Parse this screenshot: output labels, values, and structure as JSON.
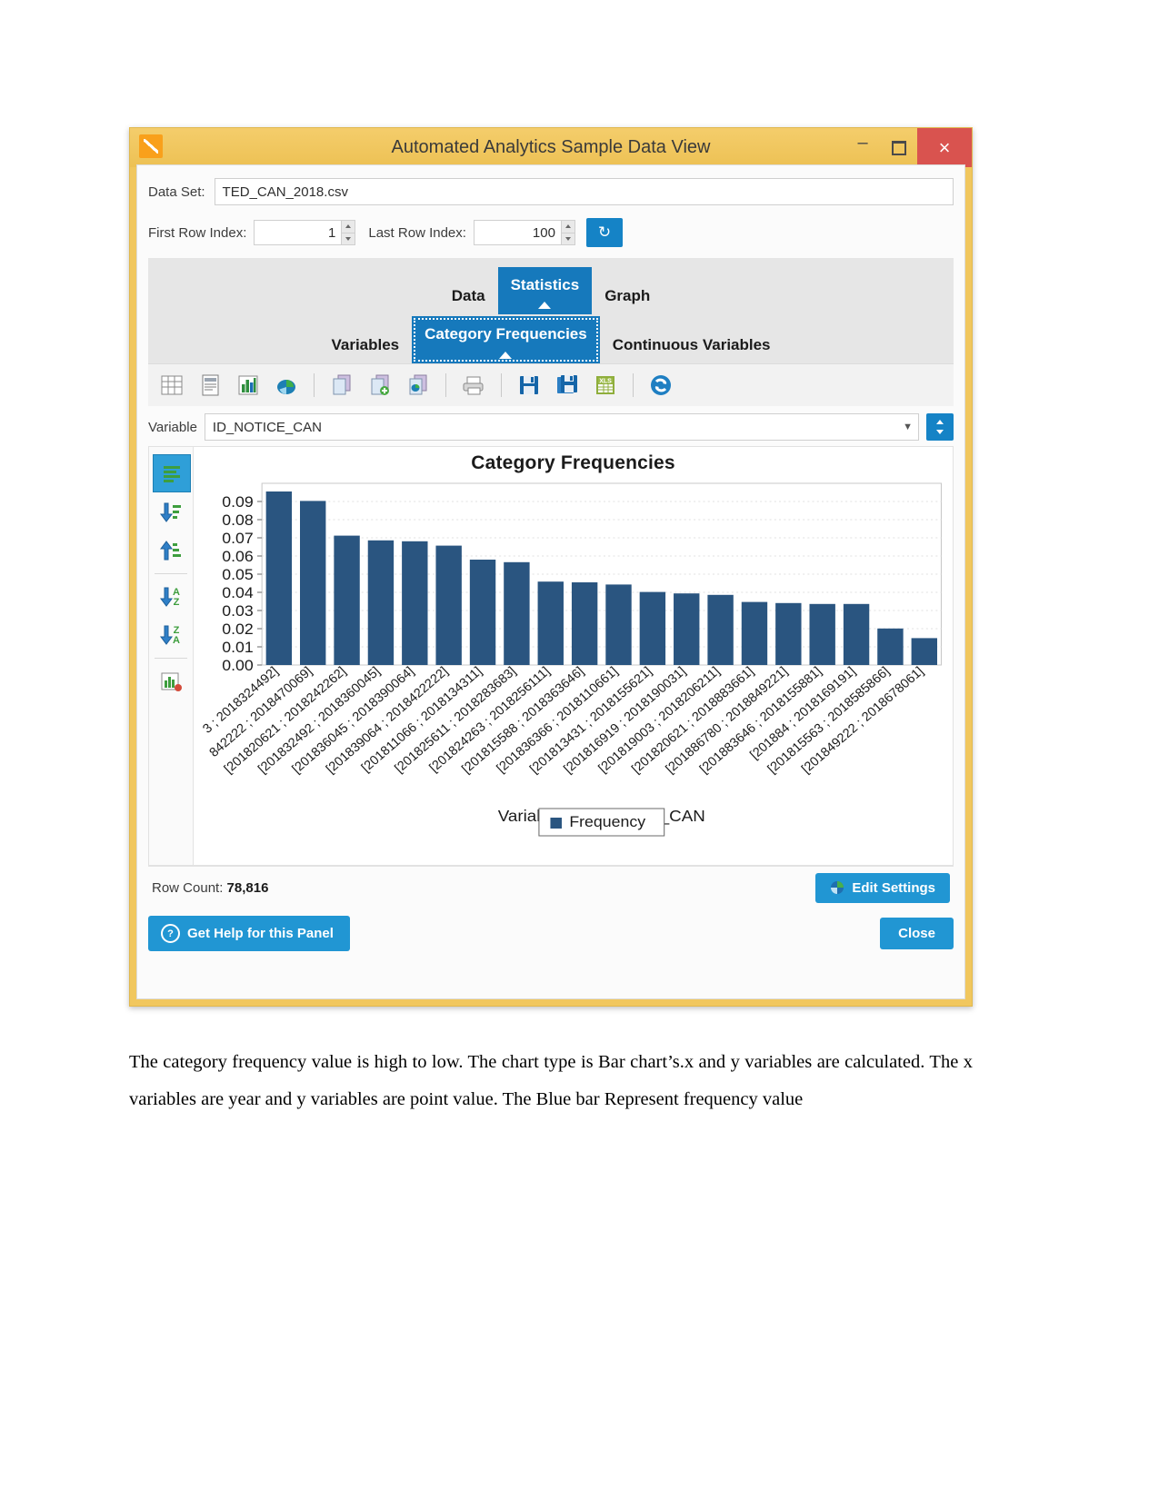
{
  "window": {
    "title": "Automated Analytics Sample Data View",
    "logo_icon": "app-chart-icon",
    "minimize_icon": "–",
    "maximize_icon": "□",
    "close_icon": "×"
  },
  "dataset": {
    "label": "Data Set:",
    "value": "TED_CAN_2018.csv"
  },
  "rowindex": {
    "first_label": "First Row Index:",
    "first_value": "1",
    "last_label": "Last Row Index:",
    "last_value": "100",
    "refresh_icon": "↻"
  },
  "tabs": {
    "primary": [
      {
        "label": "Data",
        "active": false
      },
      {
        "label": "Statistics",
        "active": true
      },
      {
        "label": "Graph",
        "active": false
      }
    ],
    "secondary": [
      {
        "label": "Variables",
        "active": false
      },
      {
        "label": "Category Frequencies",
        "active": true
      },
      {
        "label": "Continuous Variables",
        "active": false
      }
    ]
  },
  "toolbar": {
    "icons": [
      "table-grid-icon",
      "report-document-icon",
      "bar-chart-icon",
      "pie-chart-icon",
      "copy-page-icon",
      "add-page-icon",
      "copy-chart-page-icon",
      "print-icon",
      "save-icon",
      "save-as-icon",
      "export-xls-icon",
      "refresh-globe-icon"
    ]
  },
  "variable": {
    "label": "Variable",
    "value": "ID_NOTICE_CAN",
    "dropdown_icon": "chevron-down-icon",
    "sort_icon": "sort-updown-icon"
  },
  "side_tools": {
    "icons": [
      "align-bars-icon",
      "sort-descending-value-icon",
      "sort-ascending-value-icon",
      "sort-a-z-icon",
      "sort-z-a-icon",
      "chart-options-icon"
    ]
  },
  "status": {
    "row_count_label": "Row Count:",
    "row_count_value": "78,816",
    "edit_settings_label": "Edit Settings",
    "edit_settings_icon": "palette-icon"
  },
  "footer": {
    "help_label": "Get Help for this Panel",
    "help_icon": "question-circle-icon",
    "close_label": "Close"
  },
  "paragraph": "The category frequency value is high to low. The chart type is Bar chart’s.x and y variables are calculated. The x variables are year and y variables are point value. The Blue bar Represent frequency value",
  "chart_data": {
    "type": "bar",
    "title": "Category Frequencies",
    "xlabel": "Variable: ID_NOTICE_CAN",
    "ylabel": "",
    "ylim": [
      0,
      0.1
    ],
    "yticks": [
      "0.00",
      "0.01",
      "0.02",
      "0.03",
      "0.04",
      "0.05",
      "0.06",
      "0.07",
      "0.08",
      "0.09"
    ],
    "grid": true,
    "bar_color": "#2a5580",
    "legend": {
      "position": "bottom",
      "entries": [
        "Frequency"
      ]
    },
    "categories": [
      "3 ; 2018324492]",
      "842222 ; 2018470069]",
      "[201820621 ; 2018242262]",
      "[201832492 ; 2018360045]",
      "[201836045 ; 2018390064]",
      "[201839064 ; 2018422222]",
      "[201811066 ; 2018134311]",
      "[201825611 ; 2018283683]",
      "[201824263 ; 2018256111]",
      "[201815588 ; 2018363646]",
      "[201836366 ; 2018110661]",
      "[201813431 ; 2018155621]",
      "[201816919 ; 2018190031]",
      "[201819003 ; 2018206211]",
      "[201820621 ; 2018883661]",
      "[201886780 ; 2018849221]",
      "[201883646 ; 2018155881]",
      "[201884 ; 2018169191]",
      "[201815563 ; 2018585866]",
      "[201849222 ; 2018678061]"
    ],
    "values": [
      0.0955,
      0.0903,
      0.0712,
      0.0686,
      0.0681,
      0.0657,
      0.058,
      0.0566,
      0.0459,
      0.0455,
      0.0443,
      0.0402,
      0.0394,
      0.0386,
      0.0347,
      0.0341,
      0.0336,
      0.0336,
      0.0201,
      0.0148
    ],
    "series": [
      {
        "name": "Frequency",
        "values": [
          0.0955,
          0.0903,
          0.0712,
          0.0686,
          0.0681,
          0.0657,
          0.058,
          0.0566,
          0.0459,
          0.0455,
          0.0443,
          0.0402,
          0.0394,
          0.0386,
          0.0347,
          0.0341,
          0.0336,
          0.0336,
          0.0201,
          0.0148
        ]
      }
    ]
  }
}
